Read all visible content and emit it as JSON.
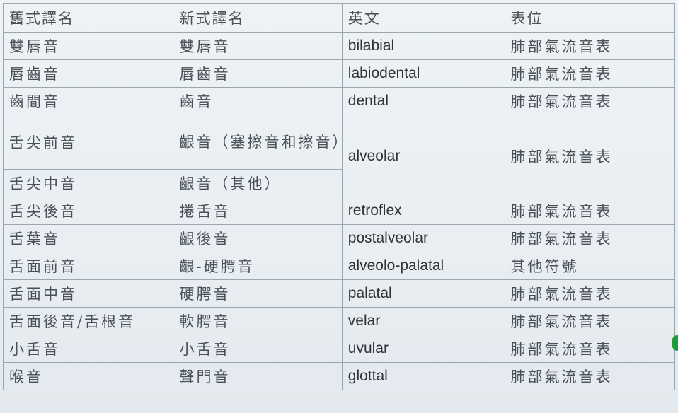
{
  "table": {
    "headers": [
      "舊式譯名",
      "新式譯名",
      "英文",
      "表位"
    ],
    "rows": [
      {
        "old": "雙唇音",
        "new": "雙唇音",
        "english": "bilabial",
        "position": "肺部氣流音表"
      },
      {
        "old": "唇齒音",
        "new": "唇齒音",
        "english": "labiodental",
        "position": "肺部氣流音表"
      },
      {
        "old": "齒間音",
        "new": "齒音",
        "english": "dental",
        "position": "肺部氣流音表"
      },
      {
        "old": "舌尖前音",
        "new": "齦音（塞擦音和擦音）",
        "english": "alveolar",
        "position": "肺部氣流音表"
      },
      {
        "old": "舌尖中音",
        "new": "齦音（其他）"
      },
      {
        "old": "舌尖後音",
        "new": "捲舌音",
        "english": "retroflex",
        "position": "肺部氣流音表"
      },
      {
        "old": "舌葉音",
        "new": "齦後音",
        "english": "postalveolar",
        "position": "肺部氣流音表"
      },
      {
        "old": "舌面前音",
        "new": "齦-硬腭音",
        "english": "alveolo-palatal",
        "position": "其他符號"
      },
      {
        "old": "舌面中音",
        "new": "硬腭音",
        "english": "palatal",
        "position": "肺部氣流音表"
      },
      {
        "old": "舌面後音/舌根音",
        "new": "軟腭音",
        "english": "velar",
        "position": "肺部氣流音表"
      },
      {
        "old": "小舌音",
        "new": "小舌音",
        "english": "uvular",
        "position": "肺部氣流音表"
      },
      {
        "old": "喉音",
        "new": "聲門音",
        "english": "glottal",
        "position": "肺部氣流音表"
      }
    ]
  },
  "colors": {
    "background": "#e9eef2",
    "border": "#9aa6b0",
    "marker": "#1f9a3a"
  }
}
